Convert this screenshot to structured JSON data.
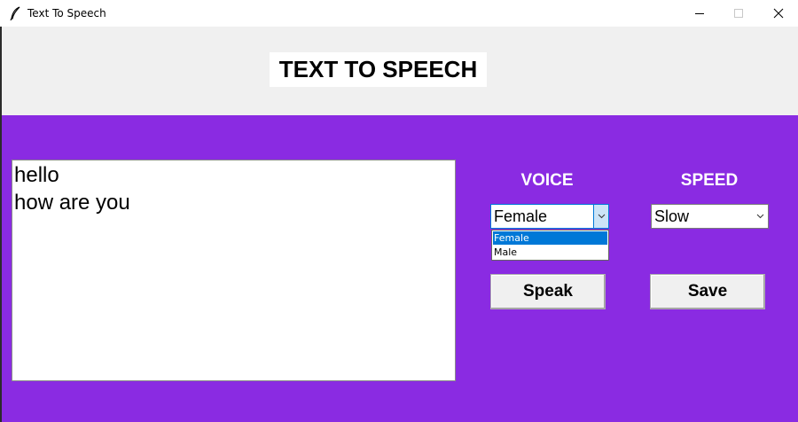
{
  "window": {
    "title": "Text To Speech",
    "icons": [
      "feather-icon",
      "minimize-icon",
      "maximize-icon",
      "close-icon"
    ]
  },
  "header": {
    "heading": "TEXT TO SPEECH"
  },
  "text_input": {
    "lines": [
      "hello",
      "how are you"
    ]
  },
  "voice": {
    "label": "VOICE",
    "selected": "Female",
    "options": [
      "Female",
      "Male"
    ],
    "highlighted_option": "Female"
  },
  "speed": {
    "label": "SPEED",
    "selected": "Slow"
  },
  "buttons": {
    "speak": "Speak",
    "save": "Save"
  },
  "colors": {
    "main_background": "#8a2be2",
    "header_background": "#f0f0f0",
    "selection_highlight": "#0078d7"
  }
}
